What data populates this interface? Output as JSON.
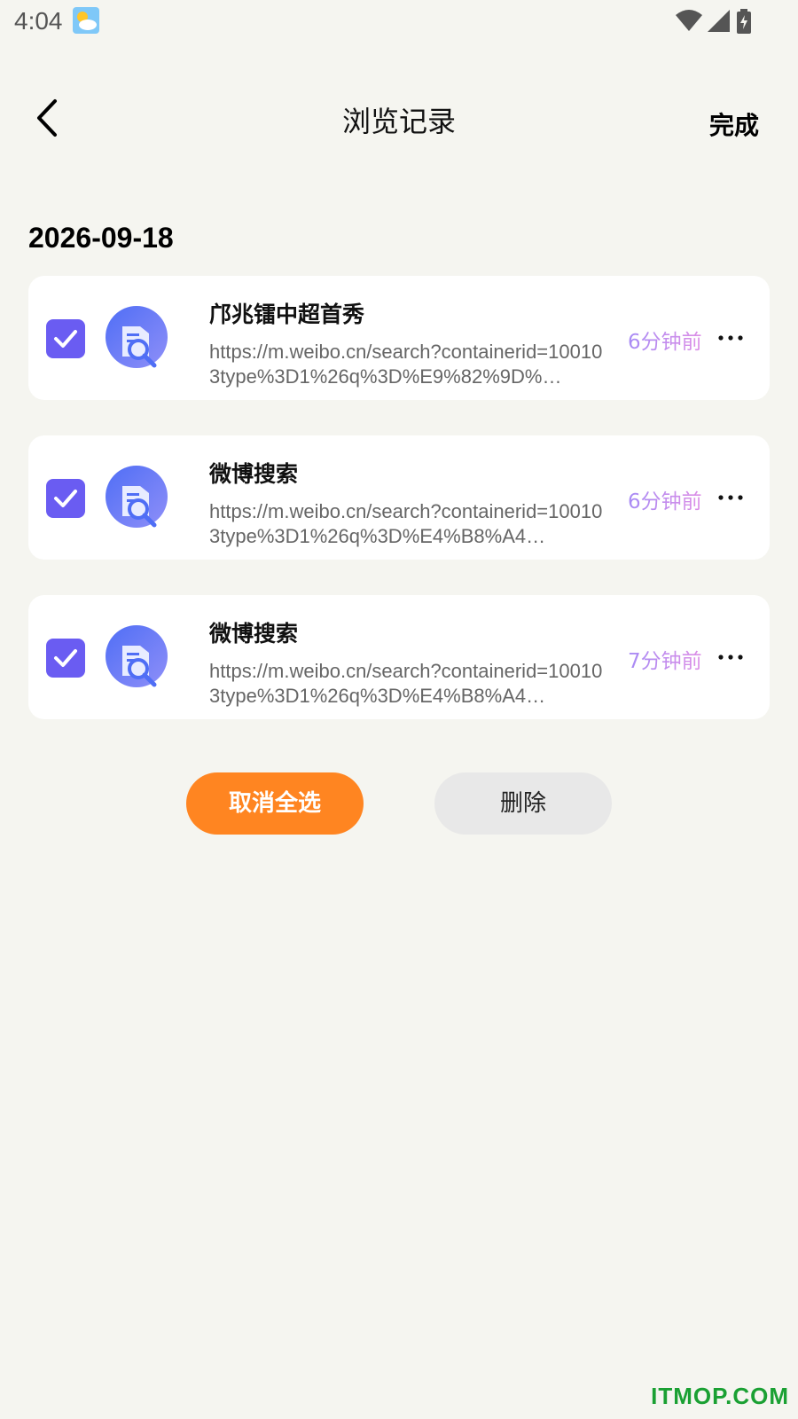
{
  "status_bar": {
    "time": "4:04",
    "weather_icon": "partly-cloudy-icon",
    "wifi_icon": "wifi-icon",
    "signal_icon": "signal-icon",
    "battery_icon": "battery-charging-icon"
  },
  "header": {
    "title": "浏览记录",
    "done_label": "完成",
    "back_icon": "chevron-left-icon"
  },
  "date_group": {
    "date": "2026-09-18"
  },
  "history_items": [
    {
      "title": "邝兆镭中超首秀",
      "url": "https://m.weibo.cn/search?containerid=100103type%3D1%26q%3D%E9%82%9D%…",
      "time": "6分钟前",
      "checked": true
    },
    {
      "title": "微博搜索",
      "url": "https://m.weibo.cn/search?containerid=100103type%3D1%26q%3D%E4%B8%A4…",
      "time": "6分钟前",
      "checked": true
    },
    {
      "title": "微博搜索",
      "url": "https://m.weibo.cn/search?containerid=100103type%3D1%26q%3D%E4%B8%A4…",
      "time": "7分钟前",
      "checked": true
    }
  ],
  "actions": {
    "deselect_all_label": "取消全选",
    "delete_label": "删除"
  },
  "watermark": "ITMOP.COM",
  "colors": {
    "accent_orange": "#ff8521",
    "checkbox_purple": "#6a5cf2",
    "time_gradient_start": "#a78bf5",
    "time_gradient_end": "#dd8ee6",
    "background": "#f5f5f0"
  }
}
